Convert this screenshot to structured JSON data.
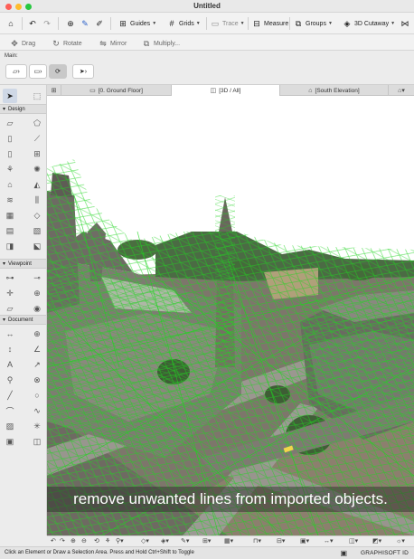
{
  "window": {
    "title": "Untitled"
  },
  "toolbar": {
    "guides_label": "Guides",
    "grids_label": "Grids",
    "trace_label": "Trace",
    "measure_label": "Measure",
    "groups_label": "Groups",
    "cutaway_label": "3D Cutaway"
  },
  "toolbar2": {
    "drag_label": "Drag",
    "rotate_label": "Rotate",
    "mirror_label": "Mirror",
    "multiply_label": "Multiply..."
  },
  "info_box": {
    "main_label": "Main:"
  },
  "toolbox": {
    "sections": {
      "design": "Design",
      "viewpoint": "Viewpoint",
      "document": "Document"
    }
  },
  "tabs": [
    {
      "label": "[0. Ground Floor]",
      "icon": "floor-plan-icon"
    },
    {
      "label": "[3D / All]",
      "icon": "3d-cube-icon"
    },
    {
      "label": "[South Elevation]",
      "icon": "elevation-icon"
    }
  ],
  "viewport": {
    "caption": "remove unwanted lines from imported objects."
  },
  "statusbar": {
    "hint": "Click an Element or Draw a Selection Area. Press and Hold Ctrl+Shift to Toggle",
    "brand": "GRAPHISOFT ID"
  },
  "colors": {
    "mesh_green": "#1fd51f",
    "sky": "#dfe3e0",
    "ground": "#8a7f70"
  }
}
